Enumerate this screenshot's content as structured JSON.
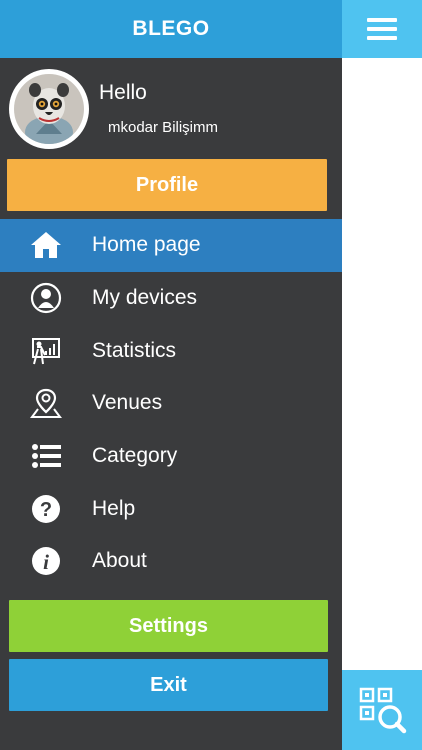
{
  "header": {
    "title": "BLEGO"
  },
  "user": {
    "greeting": "Hello",
    "name": "mkodar Bilişimm"
  },
  "buttons": {
    "profile": "Profile",
    "settings": "Settings",
    "exit": "Exit"
  },
  "menu": {
    "items": [
      {
        "label": "Home page",
        "icon": "home-icon",
        "active": true
      },
      {
        "label": "My devices",
        "icon": "person-icon",
        "active": false
      },
      {
        "label": "Statistics",
        "icon": "presentation-chart-icon",
        "active": false
      },
      {
        "label": "Venues",
        "icon": "map-pin-icon",
        "active": false
      },
      {
        "label": "Category",
        "icon": "list-icon",
        "active": false
      },
      {
        "label": "Help",
        "icon": "help-icon",
        "active": false
      },
      {
        "label": "About",
        "icon": "info-icon",
        "active": false
      }
    ]
  },
  "colors": {
    "header": "#2d9fd9",
    "drawer_bg": "#3a3b3d",
    "active_item": "#2d7fc0",
    "profile": "#f6b043",
    "settings": "#8fd137",
    "exit": "#2d9fd9",
    "right_panel": "#4fc3f0"
  }
}
